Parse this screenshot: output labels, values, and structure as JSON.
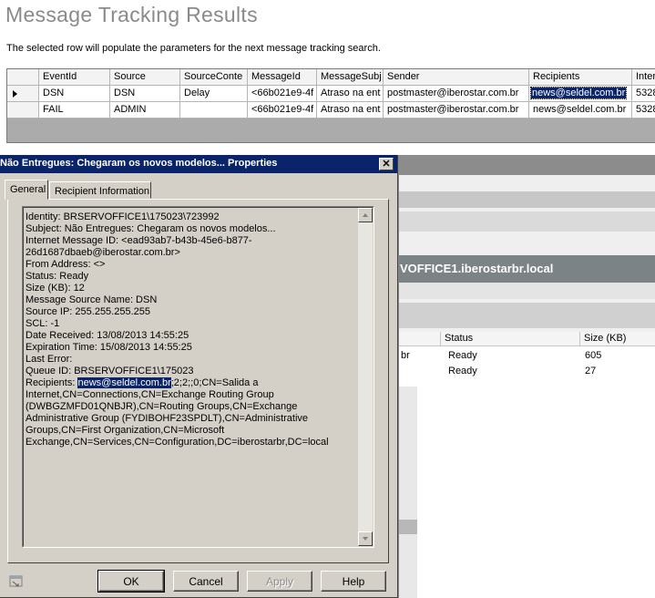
{
  "page": {
    "title": "Message Tracking Results",
    "subtitle": "The selected row will populate the parameters for the next message tracking search."
  },
  "grid": {
    "columns": [
      "EventId",
      "Source",
      "SourceConte",
      "MessageId",
      "MessageSubj",
      "Sender",
      "Recipients",
      "Inter"
    ],
    "rows": [
      [
        "DSN",
        "DSN",
        "Delay",
        "<66b021e9-4f",
        "Atraso na ent",
        "postmaster@iberostar.com.br",
        "news@seldel.com.br",
        "5328"
      ],
      [
        "FAIL",
        "ADMIN",
        "",
        "<66b021e9-4f",
        "Atraso na ent",
        "postmaster@iberostar.com.br",
        "news@seldel.com.br",
        "5328"
      ]
    ]
  },
  "background": {
    "server_title": "VOFFICE1.iberostarbr.local",
    "queue_columns": [
      "Status",
      "Size (KB)"
    ],
    "queue_rows": [
      {
        "left": "br",
        "status": "Ready",
        "size": "605"
      },
      {
        "left": "",
        "status": "Ready",
        "size": "27"
      }
    ]
  },
  "dialog": {
    "title": "Não Entregues: Chegaram os novos modelos... Properties",
    "close_glyph": "✕",
    "tabs": [
      "General",
      "Recipient Information"
    ],
    "details_before": "Identity: BRSERVOFFICE1\\175023\\723992\nSubject: Não Entregues: Chegaram os novos modelos...\nInternet Message ID: <ead93ab7-b43b-45e6-b877-26d1687dbaeb@iberostar.com.br>\nFrom Address: <>\nStatus: Ready\nSize (KB): 12\nMessage Source Name: DSN\nSource IP: 255.255.255.255\nSCL: -1\nDate Received: 13/08/2013 14:55:25\nExpiration Time: 15/08/2013 14:55:25\nLast Error:\nQueue ID: BRSERVOFFICE1\\175023\nRecipients: ",
    "details_highlight": "news@seldel.com.br",
    "details_after": ";2;2;;0;CN=Salida a Internet,CN=Connections,CN=Exchange Routing Group (DWBGZMFD01QNBJR),CN=Routing Groups,CN=Exchange Administrative Group (FYDIBOHF23SPDLT),CN=Administrative Groups,CN=First Organization,CN=Microsoft Exchange,CN=Services,CN=Configuration,DC=iberostarbr,DC=local",
    "buttons": {
      "ok": "OK",
      "cancel": "Cancel",
      "apply": "Apply",
      "help": "Help"
    }
  },
  "icons": {
    "row_selector": "triangle-right",
    "help_corner": "window-help-icon"
  }
}
